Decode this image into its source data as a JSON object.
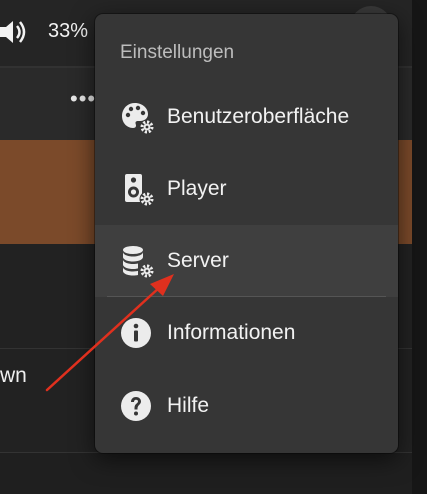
{
  "topbar": {
    "volume_text": "33%"
  },
  "toolbar": {
    "more_label": "•••"
  },
  "list": {
    "row2_text": "wn"
  },
  "menu": {
    "header": "Einstellungen",
    "items": [
      {
        "label": "Benutzeroberfläche",
        "icon": "palette-gear-icon"
      },
      {
        "label": "Player",
        "icon": "speaker-gear-icon"
      },
      {
        "label": "Server",
        "icon": "database-gear-icon"
      },
      {
        "label": "Informationen",
        "icon": "info-icon"
      },
      {
        "label": "Hilfe",
        "icon": "help-icon"
      }
    ]
  },
  "colors": {
    "menu_bg": "#363636",
    "highlight": "#3f3f3f",
    "accent_brown": "#7b4a2a",
    "annotation_arrow": "#e0301e"
  }
}
